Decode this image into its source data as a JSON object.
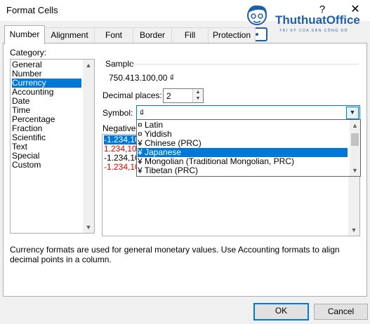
{
  "window": {
    "title": "Format Cells",
    "help_glyph": "?",
    "close_glyph": "✕"
  },
  "watermark": {
    "name": "ThuthuatOffice",
    "tagline": "TRI KỶ CỦA DÂN CÔNG SỞ"
  },
  "tabs": [
    {
      "label": "Number",
      "active": true
    },
    {
      "label": "Alignment",
      "active": false
    },
    {
      "label": "Font",
      "active": false
    },
    {
      "label": "Border",
      "active": false
    },
    {
      "label": "Fill",
      "active": false
    },
    {
      "label": "Protection",
      "active": false
    }
  ],
  "category": {
    "label": "Category:",
    "items": [
      "General",
      "Number",
      "Currency",
      "Accounting",
      "Date",
      "Time",
      "Percentage",
      "Fraction",
      "Scientific",
      "Text",
      "Special",
      "Custom"
    ],
    "selected_index": 2
  },
  "sample": {
    "label": "Sample",
    "value": "750.413.100,00 ₫"
  },
  "decimal_places": {
    "label": "Decimal places:",
    "value": "2"
  },
  "symbol": {
    "label": "Symbol:",
    "value": "₫",
    "options": [
      "¤ Latin",
      "¤ Yiddish",
      "¥ Chinese (PRC)",
      "¥ Japanese",
      "¥ Mongolian (Traditional Mongolian, PRC)",
      "¥ Tibetan (PRC)"
    ],
    "highlighted_index": 3
  },
  "negative": {
    "label": "Negative",
    "items": [
      {
        "text": "-1.234,10",
        "color": "#000000",
        "selected": true
      },
      {
        "text": "1.234,10",
        "color": "#e10000",
        "selected": false
      },
      {
        "text": "-1.234,10",
        "color": "#000000",
        "selected": false
      },
      {
        "text": "-1.234,10",
        "color": "#e10000",
        "selected": false
      }
    ]
  },
  "description": "Currency formats are used for general monetary values.  Use Accounting formats to align decimal points in a column.",
  "buttons": {
    "ok": "OK",
    "cancel": "Cancel"
  },
  "colors": {
    "selection": "#0078d7",
    "negative_red": "#e10000",
    "logo_blue": "#1d5fa8"
  }
}
